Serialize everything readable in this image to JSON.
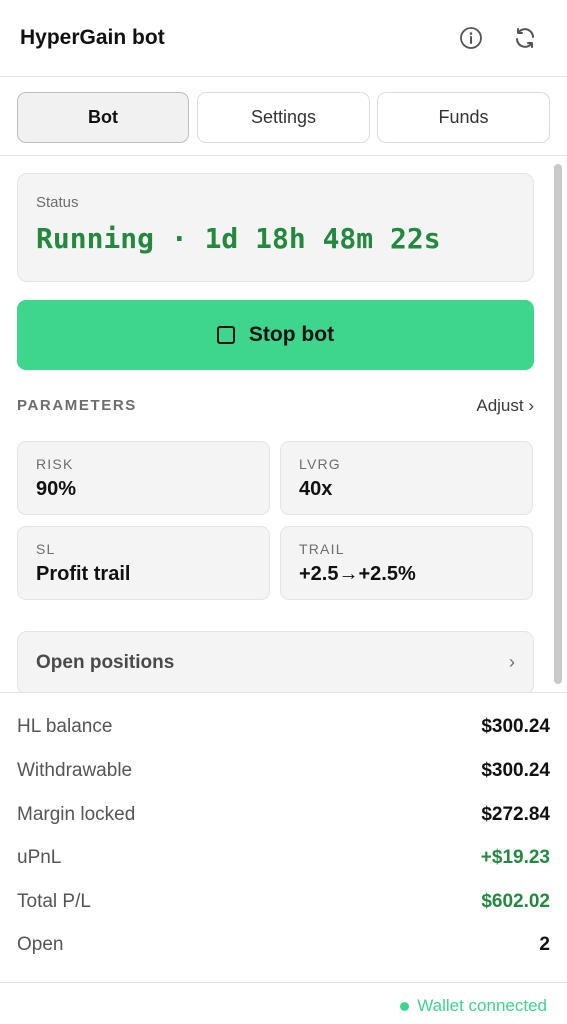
{
  "header": {
    "title": "HyperGain bot",
    "info_icon": "info-icon",
    "refresh_icon": "refresh-icon"
  },
  "tabs": [
    {
      "label": "Bot",
      "active": true
    },
    {
      "label": "Settings",
      "active": false
    },
    {
      "label": "Funds",
      "active": false
    }
  ],
  "status": {
    "label": "Status",
    "value": "Running · 1d 18h 48m 22s"
  },
  "stop_button": {
    "label": "Stop bot",
    "icon": "stop-square-icon"
  },
  "parameters": {
    "heading": "PARAMETERS",
    "adjust_label": "Adjust ›",
    "items": [
      {
        "key": "RISK",
        "value": "90%"
      },
      {
        "key": "LVRG",
        "value": "40x"
      },
      {
        "key": "SL",
        "value": "Profit trail"
      },
      {
        "key": "TRAIL",
        "value": "+2.5→+2.5%"
      }
    ]
  },
  "open_positions": {
    "label": "Open positions",
    "chevron": "›"
  },
  "summary": [
    {
      "label": "HL balance",
      "value": "$300.24",
      "color": "#111111"
    },
    {
      "label": "Withdrawable",
      "value": "$300.24",
      "color": "#111111"
    },
    {
      "label": "Margin locked",
      "value": "$272.84",
      "color": "#111111"
    },
    {
      "label": "uPnL",
      "value": "+$19.23",
      "color": "#23893f"
    },
    {
      "label": "Total P/L",
      "value": "$602.02",
      "color": "#23893f"
    },
    {
      "label": "Open",
      "value": "2",
      "color": "#111111"
    }
  ],
  "footer": {
    "wallet_status": "Wallet connected",
    "status_color": "#3dd68c"
  },
  "colors": {
    "accent": "#3dd68c",
    "running": "#23893f"
  }
}
